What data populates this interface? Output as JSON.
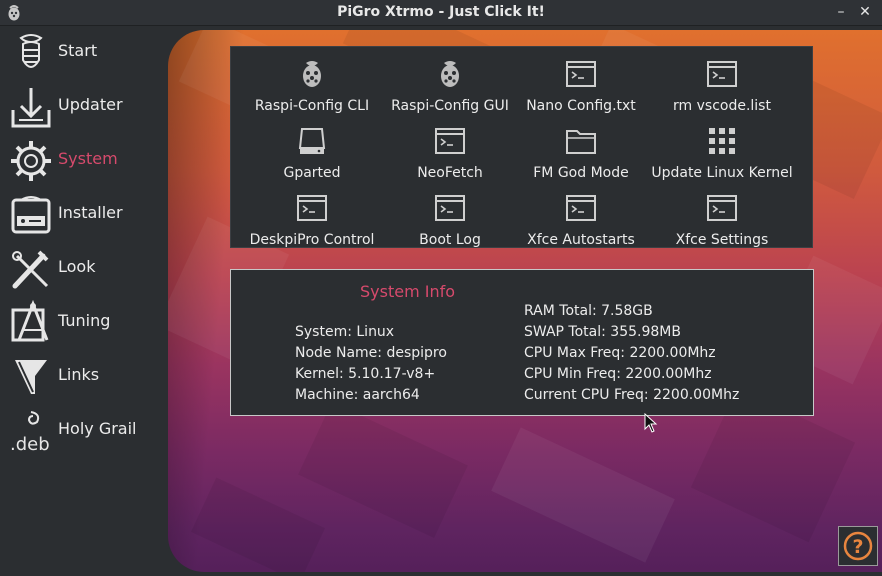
{
  "window": {
    "title": "PiGro Xtrmo - Just Click It!",
    "minimize": "–",
    "close": "✕"
  },
  "sidebar": {
    "items": [
      {
        "label": "Start",
        "icon": "raspberry-icon"
      },
      {
        "label": "Updater",
        "icon": "download-tray-icon"
      },
      {
        "label": "System",
        "icon": "gear-icon",
        "active": true
      },
      {
        "label": "Installer",
        "icon": "installer-box-icon"
      },
      {
        "label": "Look",
        "icon": "brush-wrench-icon"
      },
      {
        "label": "Tuning",
        "icon": "compass-icon"
      },
      {
        "label": "Links",
        "icon": "funnel-link-icon"
      },
      {
        "label": "Holy Grail",
        "icon": "deb-package-icon"
      }
    ]
  },
  "tools": [
    {
      "label": "Raspi-Config CLI",
      "icon": "raspberry-icon"
    },
    {
      "label": "Raspi-Config GUI",
      "icon": "raspberry-icon"
    },
    {
      "label": "Nano Config.txt",
      "icon": "terminal-icon"
    },
    {
      "label": "rm vscode.list",
      "icon": "terminal-icon"
    },
    {
      "label": "Gparted",
      "icon": "drive-icon"
    },
    {
      "label": "NeoFetch",
      "icon": "terminal-icon"
    },
    {
      "label": "FM God Mode",
      "icon": "folder-icon"
    },
    {
      "label": "Update Linux Kernel",
      "icon": "grid-icon"
    },
    {
      "label": "DeskpiPro Control",
      "icon": "terminal-icon"
    },
    {
      "label": "Boot Log",
      "icon": "terminal-icon"
    },
    {
      "label": "Xfce Autostarts",
      "icon": "terminal-icon"
    },
    {
      "label": "Xfce Settings",
      "icon": "terminal-icon"
    }
  ],
  "system_info": {
    "title": "System Info",
    "left": [
      "System: Linux",
      "Node Name: despipro",
      "Kernel: 5.10.17-v8+",
      "Machine: aarch64"
    ],
    "right": [
      "RAM Total: 7.58GB",
      "SWAP Total: 355.98MB",
      "CPU Max Freq: 2200.00Mhz",
      "CPU Min Freq: 2200.00Mhz",
      "Current CPU Freq: 2200.00Mhz"
    ]
  },
  "help": {
    "label": "?",
    "icon": "help-icon"
  },
  "colors": {
    "accent": "#d64a6c",
    "panel": "#2b2e31",
    "bg_top": "#e0702e",
    "bg_bottom": "#55205a"
  }
}
